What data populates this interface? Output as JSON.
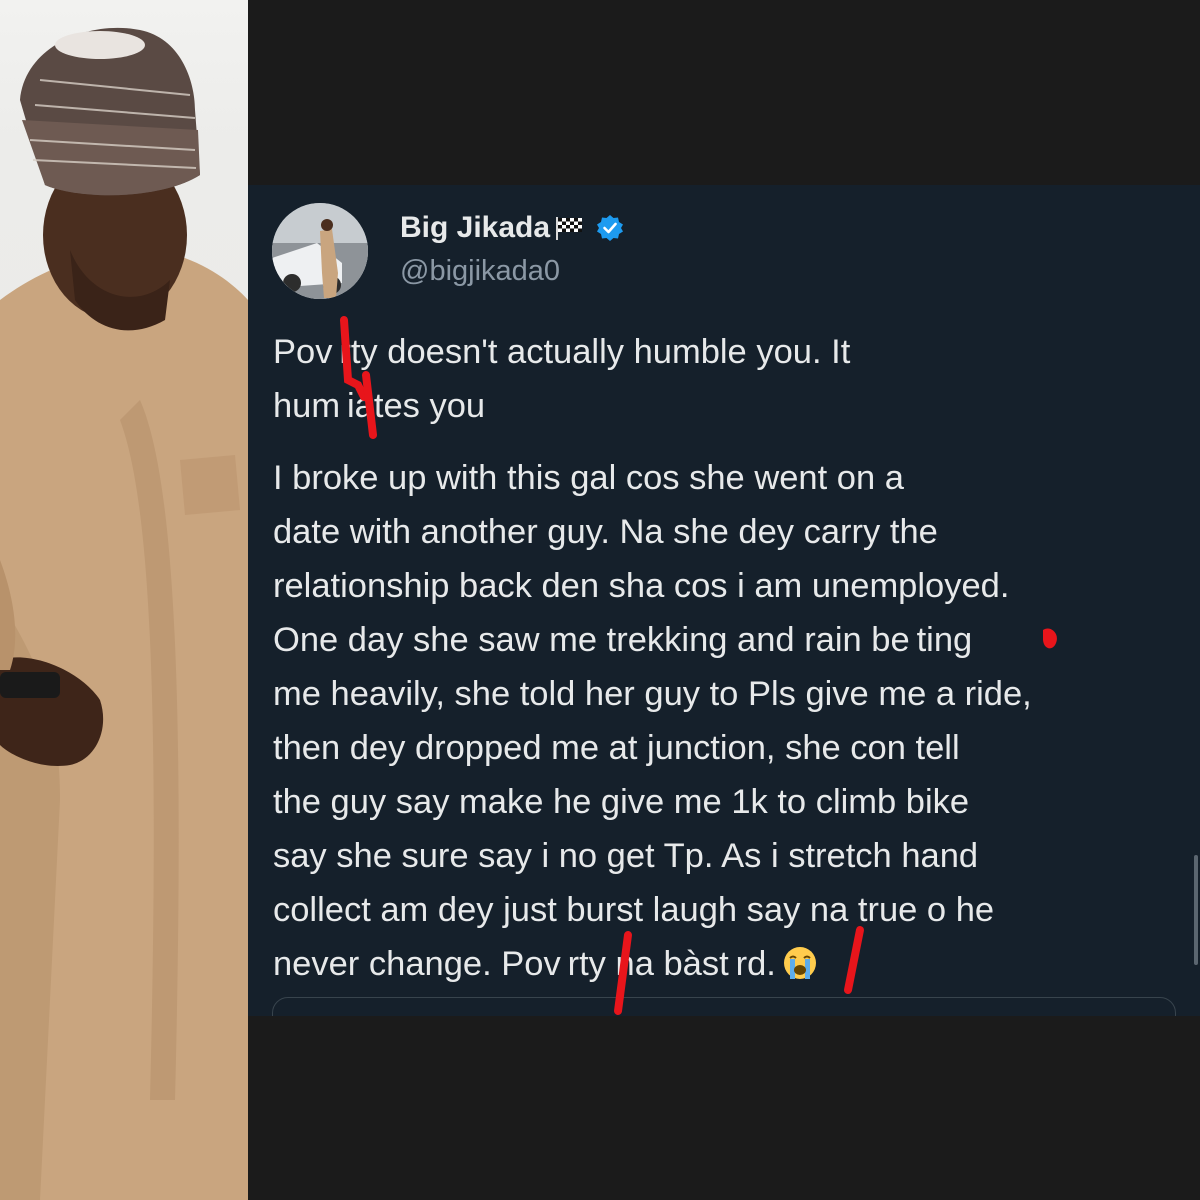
{
  "tweet": {
    "display_name": "Big Jikada",
    "handle": "@bigjikada0",
    "verified": true,
    "paragraph1": [
      "Pov rty doesn't actually humble you. It",
      "hum iates you"
    ],
    "paragraph2": [
      "I broke up with this gal cos she went on a",
      "date with another guy. Na she dey carry the",
      "relationship back den sha cos i am unemployed.",
      "One day she saw me trekking and rain be ting",
      "me heavily, she told her guy to Pls give me a ride,",
      "then dey dropped me at junction, she con tell",
      "the guy say make he give me 1k to climb bike",
      "say she sure say i no get Tp. As i stretch hand",
      "collect am dey just burst laugh say na true o he",
      "never change.  Pov rty na bàst rd."
    ],
    "emoji": "loudly-crying-face",
    "colors": {
      "background": "#15202b",
      "text": "#e7e9ea",
      "secondary": "#8b98a5",
      "verified": "#1d9bf0",
      "redaction": "#e8151b"
    }
  }
}
